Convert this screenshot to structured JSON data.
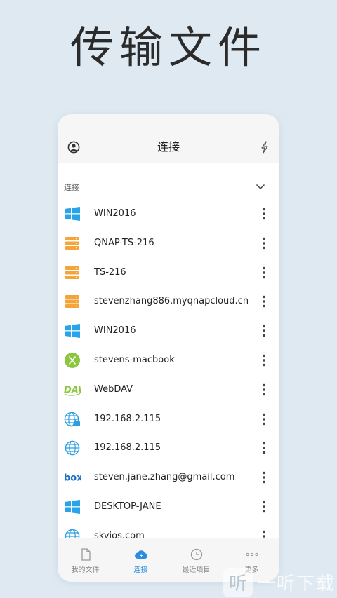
{
  "hero": {
    "title": "传输文件"
  },
  "topbar": {
    "title": "连接"
  },
  "section": {
    "label": "连接"
  },
  "connections": [
    {
      "name": "WIN2016",
      "icon": "windows-icon"
    },
    {
      "name": "QNAP-TS-216",
      "icon": "nas-server-icon"
    },
    {
      "name": "TS-216",
      "icon": "nas-server-icon"
    },
    {
      "name": "stevenzhang886.myqnapcloud.cn",
      "icon": "nas-server-icon"
    },
    {
      "name": "WIN2016",
      "icon": "windows-icon"
    },
    {
      "name": "stevens-macbook",
      "icon": "macos-x-icon"
    },
    {
      "name": "WebDAV",
      "icon": "webdav-icon"
    },
    {
      "name": "192.168.2.115",
      "icon": "globe-lock-icon"
    },
    {
      "name": "192.168.2.115",
      "icon": "globe-icon"
    },
    {
      "name": "steven.jane.zhang@gmail.com",
      "icon": "box-icon"
    },
    {
      "name": "DESKTOP-JANE",
      "icon": "windows-icon"
    },
    {
      "name": "skyios.com",
      "icon": "globe-icon"
    }
  ],
  "tabs": [
    {
      "label": "我的文件",
      "icon": "file-icon",
      "active": false
    },
    {
      "label": "连接",
      "icon": "cloud-icon",
      "active": true
    },
    {
      "label": "最近项目",
      "icon": "clock-icon",
      "active": false
    },
    {
      "label": "更多",
      "icon": "more-dots-icon",
      "active": false
    }
  ],
  "watermark": {
    "glyph": "听",
    "text": "一听下载"
  },
  "colors": {
    "background": "#dfe9f1",
    "accent": "#2a8be0",
    "windows": "#2aa4e8",
    "nas": "#f5a43a",
    "mac": "#8cc63e",
    "webdav": "#8cc63e",
    "globe": "#2a9fe0",
    "box": "#1a6fc3"
  }
}
